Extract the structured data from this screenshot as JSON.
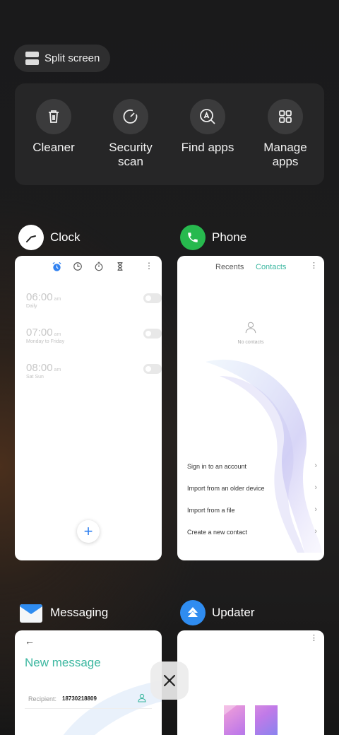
{
  "split_screen": {
    "label": "Split screen"
  },
  "quick_actions": [
    {
      "label": "Cleaner",
      "icon": "trash-icon"
    },
    {
      "label": "Security scan",
      "icon": "gauge-icon"
    },
    {
      "label": "Find apps",
      "icon": "search-app-icon"
    },
    {
      "label": "Manage apps",
      "icon": "grid-icon"
    }
  ],
  "apps": {
    "clock": {
      "name": "Clock",
      "alarms": [
        {
          "time": "06:00",
          "ampm": "am",
          "repeat": "Daily"
        },
        {
          "time": "07:00",
          "ampm": "am",
          "repeat": "Monday to Friday"
        },
        {
          "time": "08:00",
          "ampm": "am",
          "repeat": "Sat Sun"
        }
      ],
      "fab": "+"
    },
    "phone": {
      "name": "Phone",
      "tabs": [
        "Recents",
        "Contacts"
      ],
      "active_tab": "Contacts",
      "empty_label": "No contacts",
      "options": [
        "Sign in to an account",
        "Import from an older device",
        "Import from a file",
        "Create a new contact"
      ]
    },
    "messaging": {
      "name": "Messaging",
      "title": "New message",
      "recipient_label": "Recipient:",
      "recipient_value": "18730218809"
    },
    "updater": {
      "name": "Updater"
    }
  },
  "colors": {
    "accent_teal": "#3cb7a0",
    "phone_green": "#27b94e",
    "updater_blue": "#2f8cf0",
    "clock_blue": "#2f80f0"
  }
}
